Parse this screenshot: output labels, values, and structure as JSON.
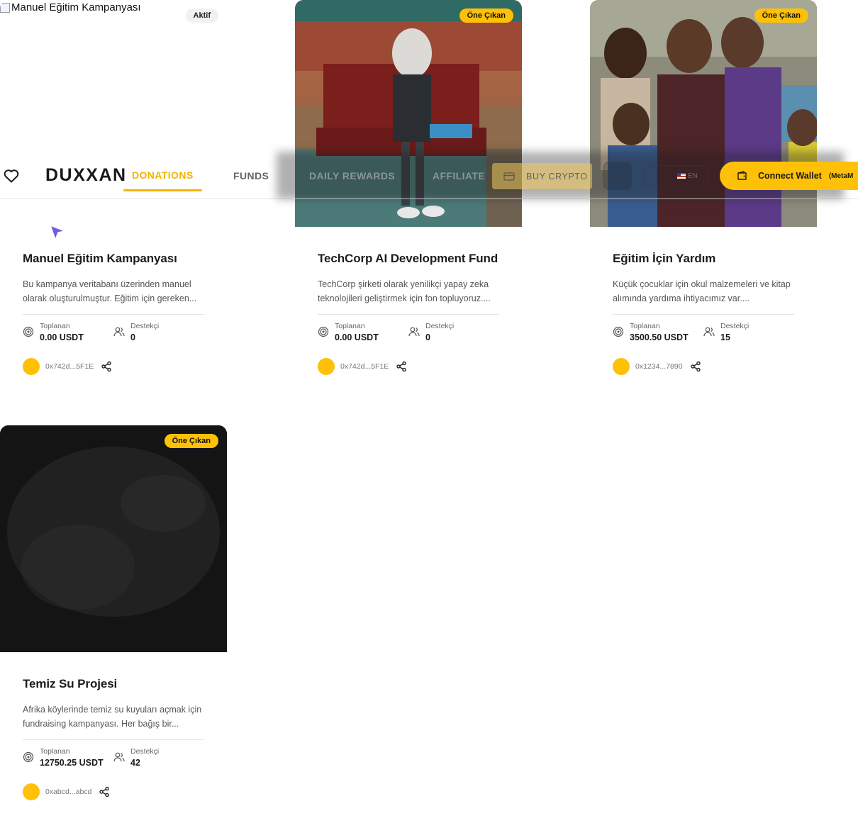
{
  "nav": {
    "logo": "DUXXAN",
    "items": [
      "DONATIONS",
      "FUNDS",
      "DAILY REWARDS",
      "AFFILIATE"
    ],
    "active": "DONATIONS",
    "buy_crypto": "BUY CRYPTO",
    "language": "EN",
    "connect_wallet": "Connect Wallet",
    "connect_wallet_sub": "(MetaM",
    "icons": [
      "heart-icon",
      "credit-card-icon",
      "moon-icon",
      "flag-us-icon",
      "wallet-icon"
    ]
  },
  "labels": {
    "raised": "Toplanan",
    "supporters": "Destekçi"
  },
  "campaigns": [
    {
      "image_alt": "Manuel Eğitim Kampanyası",
      "badge": "Aktif",
      "title": "Manuel Eğitim Kampanyası",
      "description": "Bu kampanya veritabanı üzerinden manuel olarak oluşturulmuştur. Eğitim için gereken...",
      "raised": "0.00 USDT",
      "supporters": "0",
      "address": "0x742d...5F1E"
    },
    {
      "badge": "Öne Çıkan",
      "title": "TechCorp AI Development Fund",
      "description": "TechCorp şirketi olarak yenilikçi yapay zeka teknolojileri geliştirmek için fon topluyoruz....",
      "raised": "0.00 USDT",
      "supporters": "0",
      "address": "0x742d...5F1E"
    },
    {
      "badge": "Öne Çıkan",
      "title": "Eğitim İçin Yardım",
      "description": "Küçük çocuklar için okul malzemeleri ve kitap alımında yardıma ihtiyacımız var....",
      "raised": "3500.50 USDT",
      "supporters": "15",
      "address": "0x1234...7890"
    },
    {
      "badge": "Öne Çıkan",
      "title": "Temiz Su Projesi",
      "description": "Afrika köylerinde temiz su kuyuları açmak için fundraising kampanyası. Her bağış bir...",
      "raised": "12750.25 USDT",
      "supporters": "42",
      "address": "0xabcd...abcd"
    }
  ],
  "colors": {
    "accent": "#ffc107",
    "active_nav": "#f4b400"
  }
}
